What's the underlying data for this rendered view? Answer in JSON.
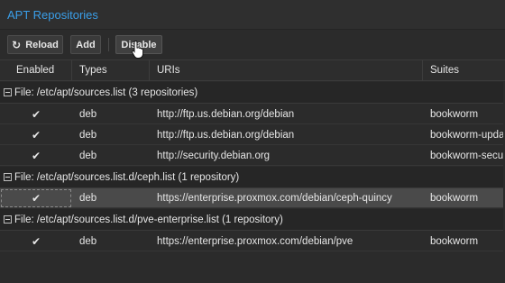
{
  "panel": {
    "title": "APT Repositories"
  },
  "toolbar": {
    "reload_label": "Reload",
    "add_label": "Add",
    "disable_label": "Disable"
  },
  "grid": {
    "columns": {
      "enabled": "Enabled",
      "types": "Types",
      "uris": "URIs",
      "suites": "Suites"
    },
    "groups": [
      {
        "label": "File: /etc/apt/sources.list (3 repositories)",
        "rows": [
          {
            "enabled": "✔",
            "type": "deb",
            "uri": "http://ftp.us.debian.org/debian",
            "suite": "bookworm",
            "selected": false
          },
          {
            "enabled": "✔",
            "type": "deb",
            "uri": "http://ftp.us.debian.org/debian",
            "suite": "bookworm-updates",
            "selected": false
          },
          {
            "enabled": "✔",
            "type": "deb",
            "uri": "http://security.debian.org",
            "suite": "bookworm-security",
            "selected": false
          }
        ]
      },
      {
        "label": "File: /etc/apt/sources.list.d/ceph.list (1 repository)",
        "rows": [
          {
            "enabled": "✔",
            "type": "deb",
            "uri": "https://enterprise.proxmox.com/debian/ceph-quincy",
            "suite": "bookworm",
            "selected": true
          }
        ]
      },
      {
        "label": "File: /etc/apt/sources.list.d/pve-enterprise.list (1 repository)",
        "rows": [
          {
            "enabled": "✔",
            "type": "deb",
            "uri": "https://enterprise.proxmox.com/debian/pve",
            "suite": "bookworm",
            "selected": false
          }
        ]
      }
    ]
  },
  "colors": {
    "accent_title": "#3a9ee8",
    "background": "#2b2b2b",
    "selected_row": "#4a4a4a"
  },
  "icons": {
    "reload": "refresh-icon",
    "group_toggle": "collapse-minus-icon",
    "enabled_check": "checkmark-icon",
    "cursor": "hand-pointer-icon"
  }
}
